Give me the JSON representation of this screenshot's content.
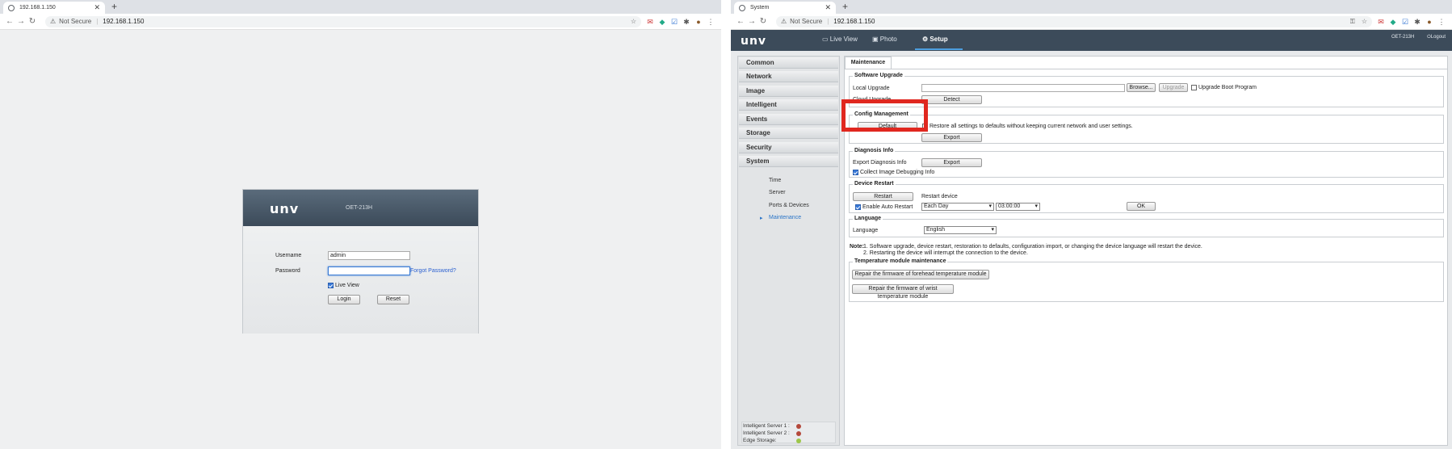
{
  "window1": {
    "tab_title": "192.168.1.150",
    "security_label": "Not Secure",
    "url": "192.168.1.150",
    "login": {
      "logo": "unv",
      "model": "OET-213H",
      "username_label": "Username",
      "username_value": "admin",
      "password_label": "Password",
      "forgot_link": "Forgot Password?",
      "live_view_label": "Live View",
      "live_view_checked": true,
      "login_button": "Login",
      "reset_button": "Reset"
    }
  },
  "window2": {
    "tab_title": "System",
    "security_label": "Not Secure",
    "url": "192.168.1.150",
    "app": {
      "logo": "unv",
      "nav": [
        "Live View",
        "Photo",
        "Setup"
      ],
      "active_nav": "Setup",
      "model": "OET-213H",
      "logout": "Logout"
    },
    "sidebar": {
      "items": [
        "Common",
        "Network",
        "Image",
        "Intelligent",
        "Events",
        "Storage",
        "Security",
        "System"
      ],
      "subitems": [
        "Time",
        "Server",
        "Ports & Devices",
        "Maintenance"
      ],
      "active_subitem": "Maintenance",
      "status": [
        {
          "label": "Intelligent Server 1 :",
          "color": "#b4493c"
        },
        {
          "label": "Intelligent Server 2 :",
          "color": "#b4493c"
        },
        {
          "label": "Edge Storage:",
          "color": "#9dc74a"
        }
      ]
    },
    "content": {
      "tab": "Maintenance",
      "software_upgrade": {
        "title": "Software Upgrade",
        "local_label": "Local Upgrade",
        "browse": "Browse...",
        "upgrade": "Upgrade",
        "boot_label": "Upgrade Boot Program",
        "cloud_label": "Cloud Upgrade",
        "detect": "Detect"
      },
      "config": {
        "title": "Config Management",
        "default": "Default",
        "restore_label": "Restore all settings to defaults without keeping current network and user settings.",
        "export": "Export"
      },
      "diagnosis": {
        "title": "Diagnosis Info",
        "export_label": "Export Diagnosis Info",
        "export": "Export",
        "collect_label": "Collect Image Debugging Info"
      },
      "restart": {
        "title": "Device Restart",
        "restart": "Restart",
        "restart_label": "Restart device",
        "auto_label": "Enable Auto Restart",
        "frequency": "Each Day",
        "time": "03:00:00",
        "ok": "OK"
      },
      "language": {
        "title": "Language",
        "label": "Language",
        "value": "English"
      },
      "note": {
        "prefix": "Note:",
        "line1": "1. Software upgrade, device restart, restoration to defaults, configuration import, or changing the device language will restart the device.",
        "line2": "2. Restarting the device will interrupt the connection to the device."
      },
      "temperature": {
        "title": "Temperature module maintenance",
        "forehead": "Repair the firmware of forehead temperature module",
        "wrist": "Repair the firmware of wrist temperature module"
      }
    }
  }
}
